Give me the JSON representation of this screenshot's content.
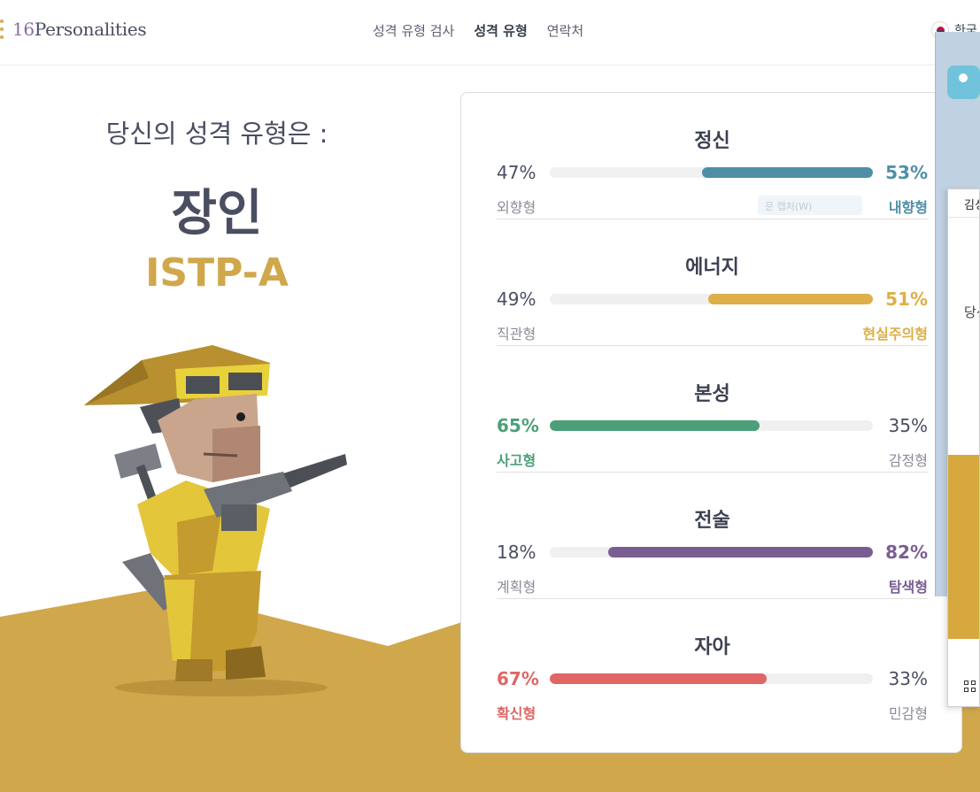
{
  "header": {
    "logo_num": "16",
    "logo_word": "Personalities",
    "nav": [
      "성격 유형 검사",
      "성격 유형",
      "연락처"
    ],
    "active_nav": 1,
    "language": "한국"
  },
  "hero": {
    "intro": "당신의 성격 유형은 :",
    "type_name": "장인",
    "type_code": "ISTP-A"
  },
  "colors": {
    "blue": "#4f8fa6",
    "yellow": "#deaf48",
    "green": "#4ca079",
    "purple": "#7a5e93",
    "red": "#e06666",
    "ground": "#d0a84b"
  },
  "traits": [
    {
      "title": "정신",
      "left_pct": "47%",
      "right_pct": "53%",
      "left_label": "외향형",
      "right_label": "내향형",
      "dominant": "right",
      "value": 53,
      "color": "#4f8fa6"
    },
    {
      "title": "에너지",
      "left_pct": "49%",
      "right_pct": "51%",
      "left_label": "직관형",
      "right_label": "현실주의형",
      "dominant": "right",
      "value": 51,
      "color": "#deaf48"
    },
    {
      "title": "본성",
      "left_pct": "65%",
      "right_pct": "35%",
      "left_label": "사고형",
      "right_label": "감정형",
      "dominant": "left",
      "value": 65,
      "color": "#4ca079"
    },
    {
      "title": "전술",
      "left_pct": "18%",
      "right_pct": "82%",
      "left_label": "계획형",
      "right_label": "탐색형",
      "dominant": "right",
      "value": 82,
      "color": "#7a5e93"
    },
    {
      "title": "자아",
      "left_pct": "67%",
      "right_pct": "33%",
      "left_label": "확신형",
      "right_label": "민감형",
      "dominant": "left",
      "value": 67,
      "color": "#e06666"
    }
  ],
  "overlay": {
    "ghost_text": "문 캡처(W)",
    "popup_title": "김성",
    "popup_text": "당신"
  }
}
